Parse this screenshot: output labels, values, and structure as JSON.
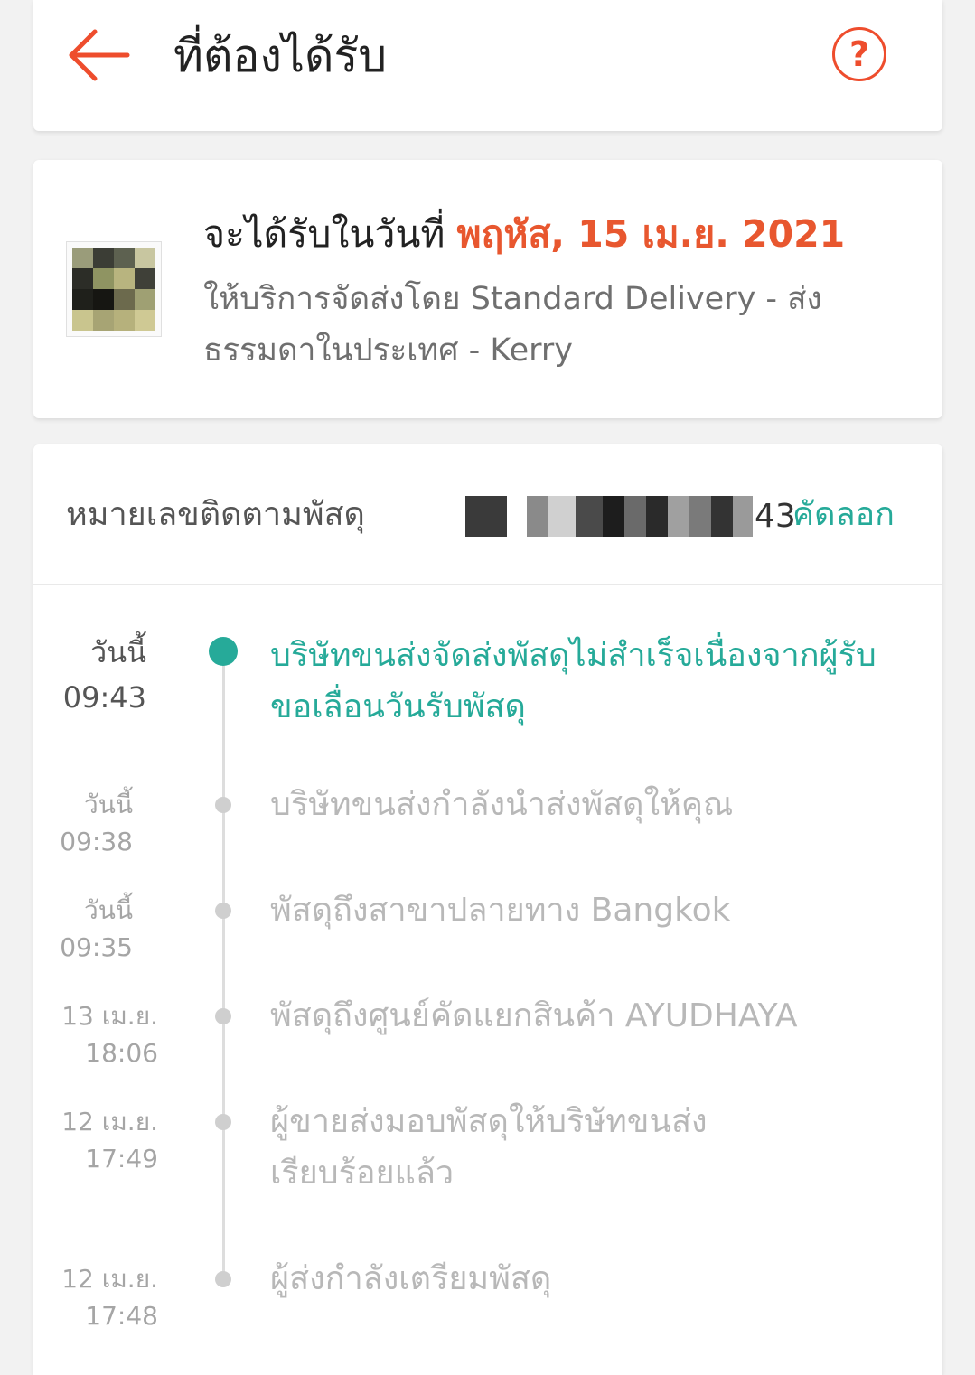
{
  "header": {
    "title": "ที่ต้องได้รับ",
    "back_icon": "arrow-left-icon",
    "help_icon": "question-circle-icon",
    "help_glyph": "?"
  },
  "delivery": {
    "estimate_prefix": "จะได้รับในวันที่ ",
    "estimate_date": "พฤหัส, 15 เม.ย. 2021",
    "service_text": "ให้บริการจัดส่งโดย Standard Delivery - ส่งธรรมดาในประเทศ - Kerry"
  },
  "tracking": {
    "label": "หมายเลขติดตามพัสดุ",
    "number_visible_tail": "43",
    "copy_label": "คัดลอก"
  },
  "timeline": [
    {
      "day": "วันนี้",
      "time": "09:43",
      "text": "บริษัทขนส่งจัดส่งพัสดุไม่สำเร็จเนื่องจากผู้รับขอเลื่อนวันรับพัสดุ",
      "active": true
    },
    {
      "day": "วันนี้",
      "time": "09:38",
      "text": "บริษัทขนส่งกำลังนำส่งพัสดุให้คุณ",
      "active": false
    },
    {
      "day": "วันนี้",
      "time": "09:35",
      "text": "พัสดุถึงสาขาปลายทาง Bangkok",
      "active": false
    },
    {
      "day": "13 เม.ย.",
      "time": "18:06",
      "text": "พัสดุถึงศูนย์คัดแยกสินค้า AYUDHAYA",
      "active": false
    },
    {
      "day": "12 เม.ย.",
      "time": "17:49",
      "text": "ผู้ขายส่งมอบพัสดุให้บริษัทขนส่งเรียบร้อยแล้ว",
      "active": false
    },
    {
      "day": "12 เม.ย.",
      "time": "17:48",
      "text": "ผู้ส่งกำลังเตรียมพัสดุ",
      "active": false
    }
  ],
  "colors": {
    "accent": "#ee4d2d",
    "date_red": "#e8572f",
    "teal": "#26aa99"
  }
}
